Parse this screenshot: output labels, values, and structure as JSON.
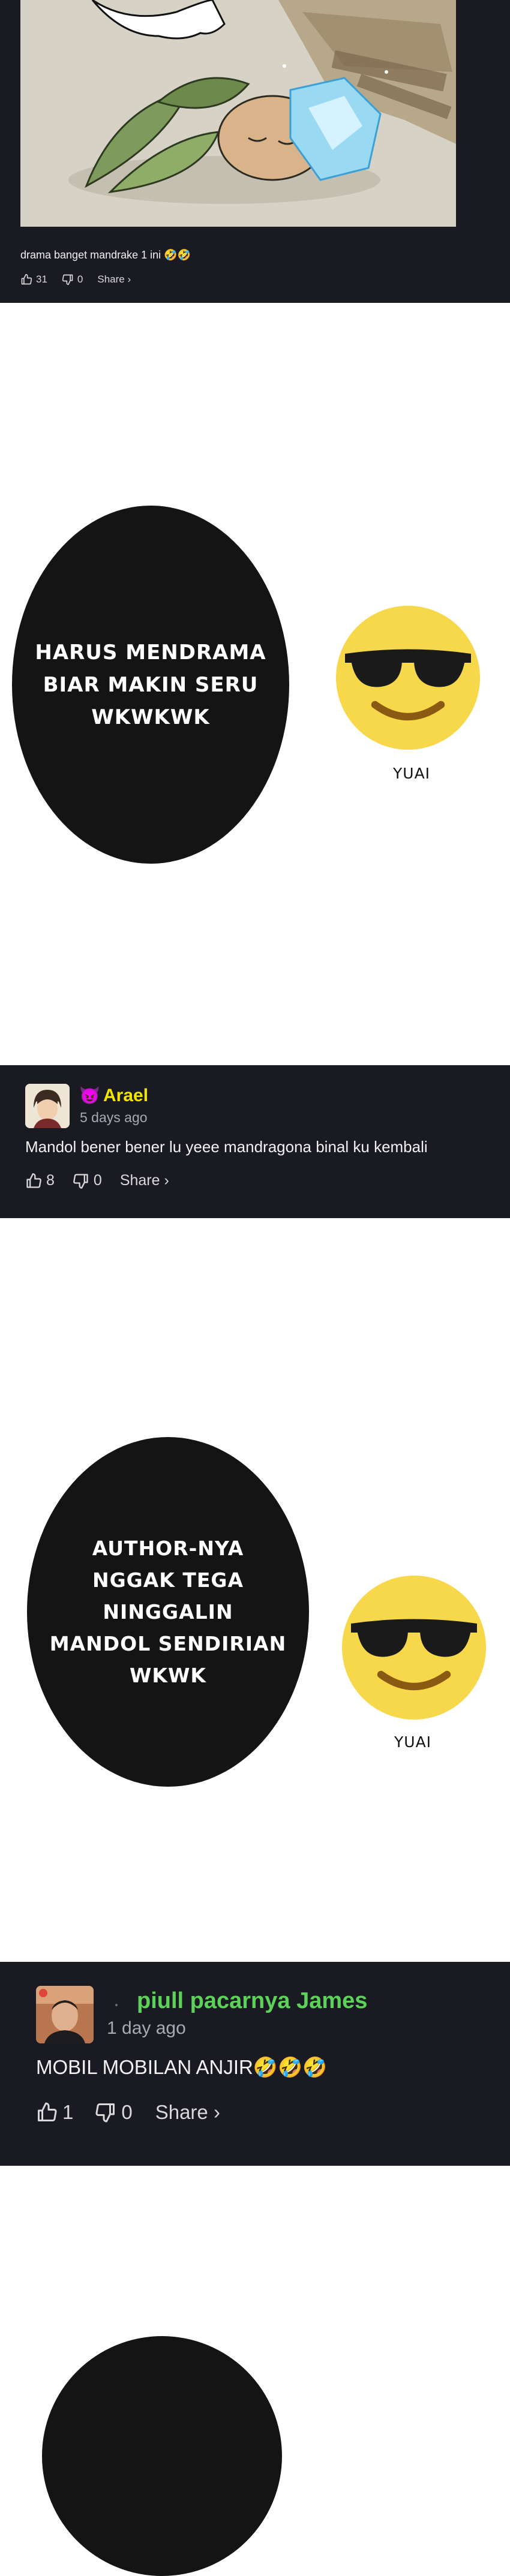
{
  "comments": [
    {
      "text": "drama banget mandrake 1 ini 🤣🤣",
      "likes": "31",
      "dislikes": "0",
      "share": "Share ›"
    },
    {
      "badge": "😈",
      "username": "Arael",
      "time": "5 days ago",
      "text": "Mandol bener bener lu yeee mandragona binal ku kembali",
      "likes": "8",
      "dislikes": "0",
      "share": "Share ›",
      "username_color": "#f2e600"
    },
    {
      "username": "piull pacarnya James",
      "time": "1 day ago",
      "text": "MOBIL MOBILAN ANJIR🤣🤣🤣",
      "likes": "1",
      "dislikes": "0",
      "share": "Share ›",
      "username_color": "#5dd15a"
    }
  ],
  "panels": [
    {
      "bubble_text": "HARUS MENDRAMA\nBIAR MAKIN SERU\nWKWKWK",
      "credit": "YUAI"
    },
    {
      "bubble_text": "AUTHOR-NYA\nNGGAK TEGA NINGGALIN\nMANDOL SENDIRIAN\nWKWK",
      "credit": "YUAI"
    }
  ],
  "icons": {
    "like": "thumbs-up-icon",
    "dislike": "thumbs-down-icon",
    "emoji": "sunglasses-emoji-icon"
  },
  "colors": {
    "card_bg": "#1a1b22",
    "bubble_bg": "#141414",
    "emoji_face": "#f7d84a"
  }
}
